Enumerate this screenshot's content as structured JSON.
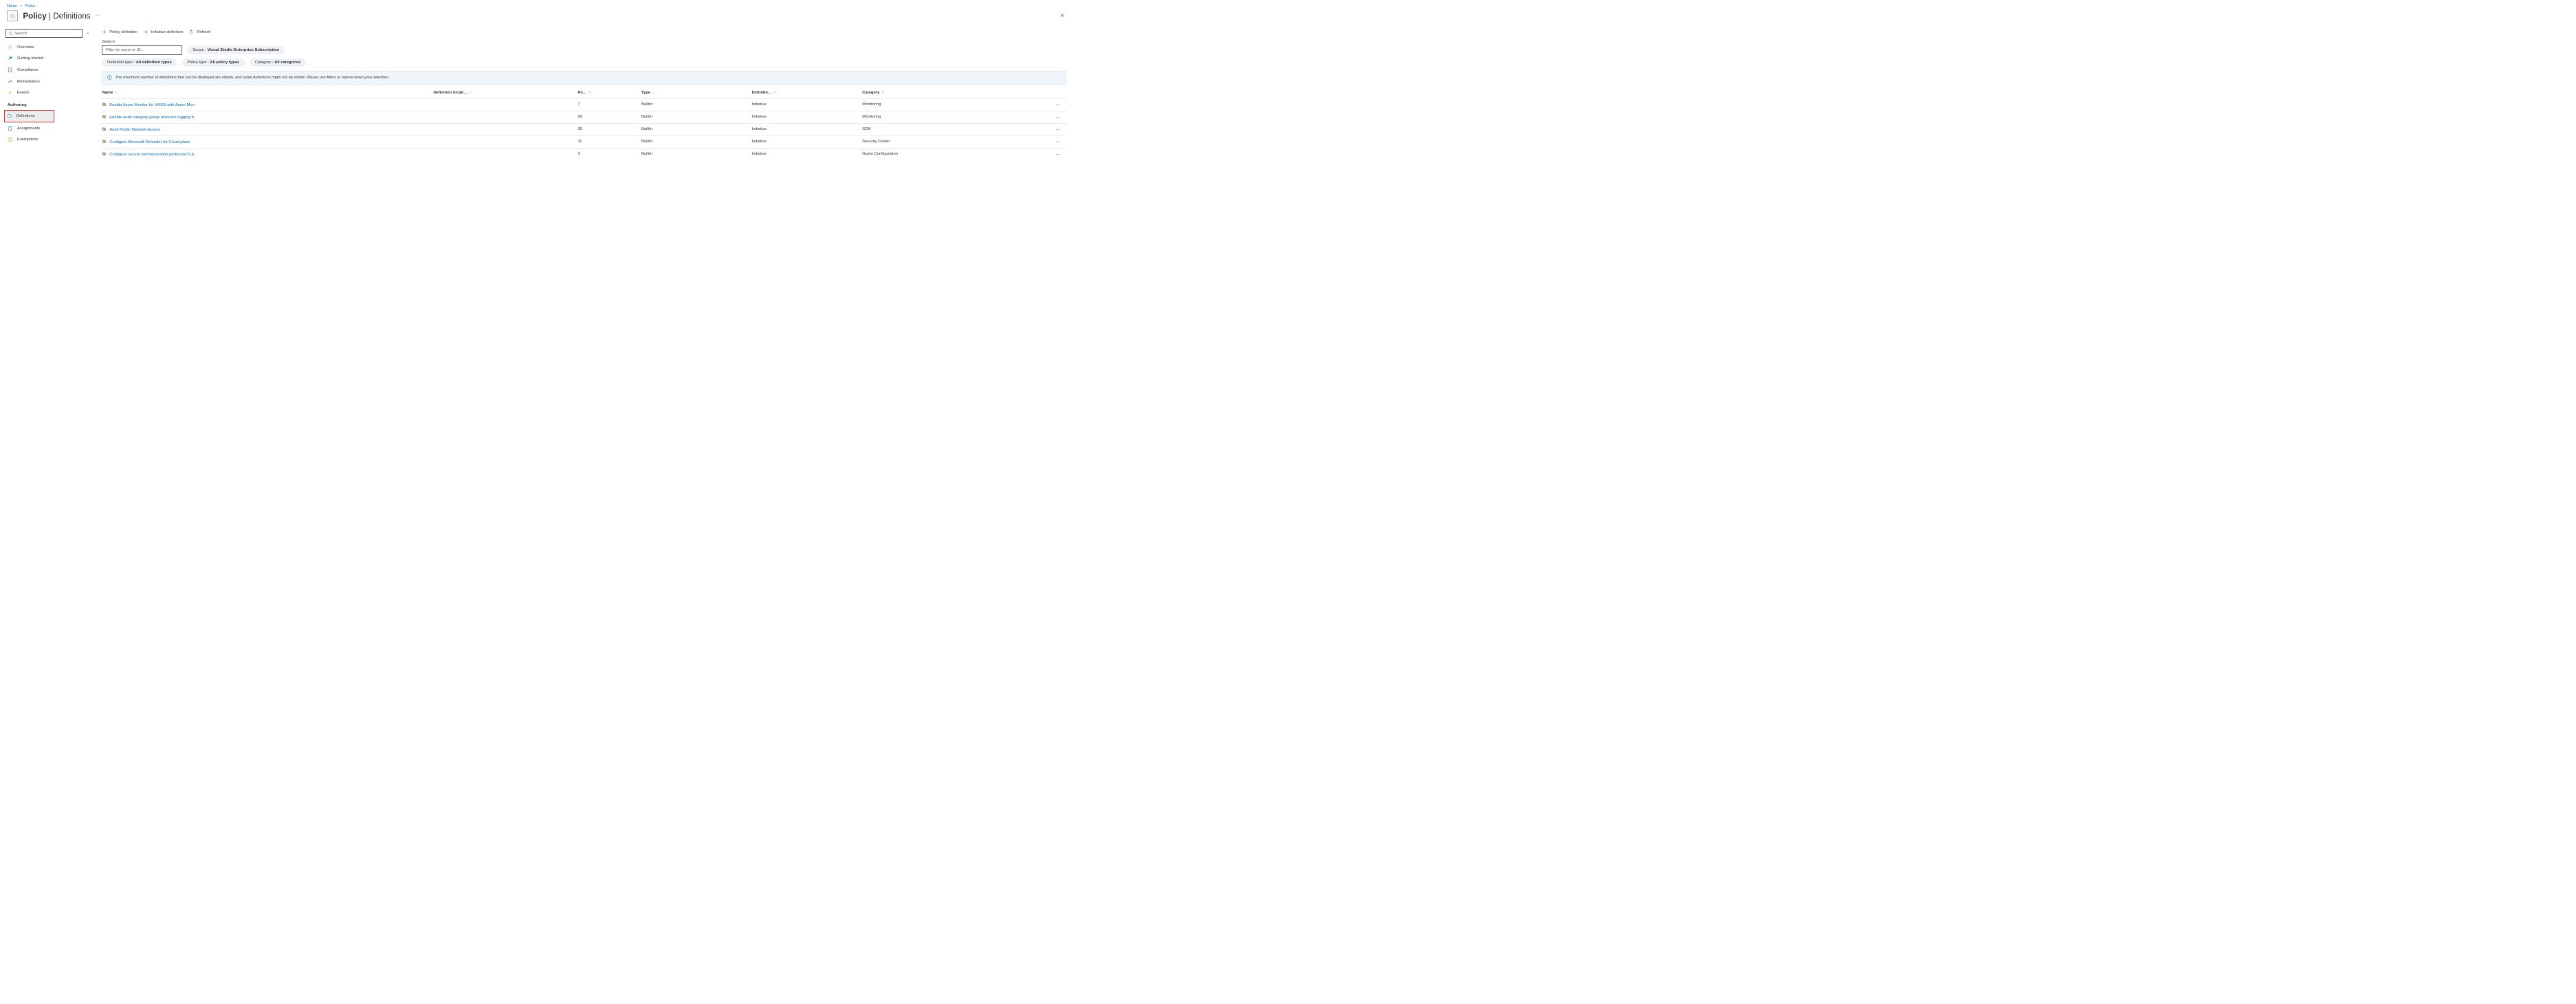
{
  "breadcrumb": {
    "home": "Home",
    "policy": "Policy"
  },
  "header": {
    "title_bold": "Policy",
    "title_rest": "Definitions"
  },
  "sidebar": {
    "search_placeholder": "Search",
    "items": [
      {
        "label": "Overview"
      },
      {
        "label": "Getting started"
      },
      {
        "label": "Compliance"
      },
      {
        "label": "Remediation"
      },
      {
        "label": "Events"
      }
    ],
    "authoring_label": "Authoring",
    "authoring_items": [
      {
        "label": "Definitions"
      },
      {
        "label": "Assignments"
      },
      {
        "label": "Exemptions"
      }
    ]
  },
  "toolbar": {
    "policy_def": "Policy definition",
    "initiative_def": "Initiative definition",
    "refresh": "Refresh"
  },
  "filters": {
    "search_label": "Search",
    "search_placeholder": "Filter by name or ID...",
    "scope_label": "Scope : ",
    "scope_value": "Visual Studio Enterprise Subscription",
    "deftype_label": "Definition type : ",
    "deftype_value": "All definition types",
    "poltype_label": "Policy type : ",
    "poltype_value": "All policy types",
    "category_label": "Category : ",
    "category_value": "All categories"
  },
  "info": "The maximum number of definitions that can be displayed are shown, and some definitions might not be visible. Please use filters to narrow down your selection.",
  "columns": {
    "name": "Name",
    "location": "Definition locati…",
    "po": "Po…",
    "type": "Type",
    "def": "Definitio…",
    "category": "Category"
  },
  "rows": [
    {
      "name": "Enable Azure Monitor for VMSS with Azure Mon",
      "po": "7",
      "type": "BuiltIn",
      "def": "Initiative",
      "category": "Monitoring"
    },
    {
      "name": "Enable audit category group resource logging fc",
      "po": "69",
      "type": "BuiltIn",
      "def": "Initiative",
      "category": "Monitoring"
    },
    {
      "name": "Audit Public Network Access",
      "po": "35",
      "type": "BuiltIn",
      "def": "Initiative",
      "category": "SDN"
    },
    {
      "name": "Configure Microsoft Defender for Cloud plans",
      "po": "11",
      "type": "BuiltIn",
      "def": "Initiative",
      "category": "Security Center"
    },
    {
      "name": "Configure secure communication protocols(TLS",
      "po": "3",
      "type": "BuiltIn",
      "def": "Initiative",
      "category": "Guest Configuration"
    }
  ]
}
